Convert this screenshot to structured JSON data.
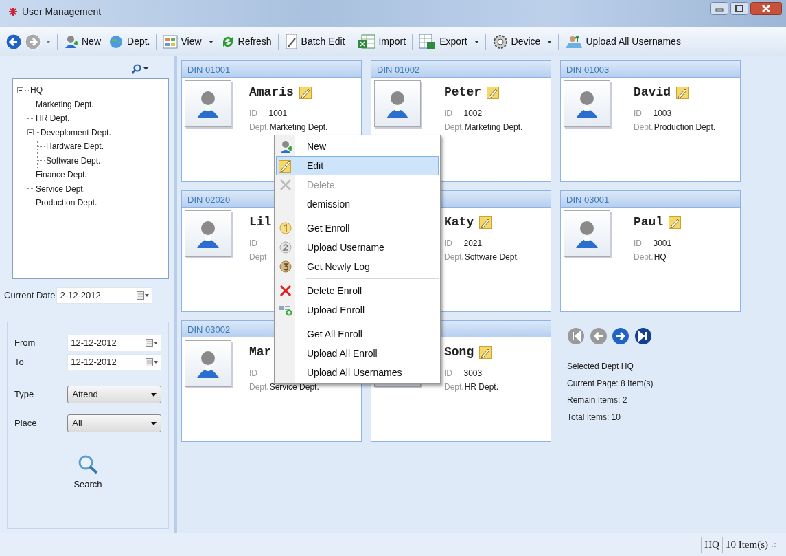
{
  "window": {
    "title": "User Management"
  },
  "toolbar": [
    {
      "kind": "back",
      "disabled": false
    },
    {
      "kind": "forward",
      "disabled": true,
      "dropdown": true
    },
    {
      "kind": "new",
      "label": "New"
    },
    {
      "kind": "dept",
      "label": "Dept."
    },
    {
      "kind": "view",
      "label": "View",
      "dropdown": true
    },
    {
      "kind": "refresh",
      "label": "Refresh"
    },
    {
      "kind": "batch",
      "label": "Batch Edit"
    },
    {
      "kind": "import",
      "label": "Import"
    },
    {
      "kind": "export",
      "label": "Export",
      "dropdown": true
    },
    {
      "kind": "device",
      "label": "Device",
      "dropdown": true
    },
    {
      "kind": "upload",
      "label": "Upload All Usernames"
    }
  ],
  "tree": [
    {
      "label": "HQ",
      "expanded": true,
      "children": [
        {
          "label": "Marketing Dept."
        },
        {
          "label": "HR Dept."
        },
        {
          "label": "Deveploment Dept.",
          "expanded": true,
          "children": [
            {
              "label": "Hardware Dept."
            },
            {
              "label": "Software Dept."
            }
          ]
        },
        {
          "label": "Finance Dept."
        },
        {
          "label": "Service Dept."
        },
        {
          "label": "Production Dept."
        }
      ]
    }
  ],
  "current_date": {
    "label": "Current Date",
    "value": "2-12-2012"
  },
  "filter": {
    "from": {
      "label": "From",
      "value": "12-12-2012"
    },
    "to": {
      "label": "To",
      "value": "12-12-2012"
    },
    "type": {
      "label": "Type",
      "value": "Attend"
    },
    "place": {
      "label": "Place",
      "value": "All"
    },
    "search": "Search"
  },
  "cards": [
    {
      "din": "DIN 01001",
      "name": "Amaris",
      "id_label": "ID",
      "id": "1001",
      "dept_label": "Dept.",
      "dept": "Marketing Dept."
    },
    {
      "din": "DIN 01002",
      "name": "Peter",
      "id_label": "ID",
      "id": "1002",
      "dept_label": "Dept.",
      "dept": "Marketing Dept."
    },
    {
      "din": "DIN 01003",
      "name": "David",
      "id_label": "ID",
      "id": "1003",
      "dept_label": "Dept.",
      "dept": "Production Dept."
    },
    {
      "din": "DIN 02020",
      "name": "Lil",
      "id_label": "ID",
      "dept_label": "Dept"
    },
    {
      "name": "Katy",
      "id_label": "ID",
      "id": "2021",
      "dept_label": "Dept.",
      "dept": "Software Dept."
    },
    {
      "din": "DIN 03001",
      "name": "Paul",
      "id_label": "ID",
      "id": "3001",
      "dept_label": "Dept.",
      "dept": "HQ"
    },
    {
      "din": "DIN 03002",
      "name": "Mar",
      "id_label": "ID",
      "dept_label": "Dept.",
      "dept": "Service Dept."
    },
    {
      "name": "Song",
      "id_label": "ID",
      "id": "3003",
      "dept_label": "Dept.",
      "dept": "HR Dept."
    }
  ],
  "pager": [
    {
      "kind": "first",
      "disabled": true
    },
    {
      "kind": "prev",
      "disabled": true
    },
    {
      "kind": "next",
      "disabled": false
    },
    {
      "kind": "last",
      "disabled": false
    }
  ],
  "info": [
    "Selected Dept HQ",
    "Current Page: 8 Item(s)",
    "Remain Items: 2",
    "Total Items: 10"
  ],
  "context_menu": [
    [
      {
        "kind": "new",
        "label": "New",
        "selected": false,
        "disabled": false
      },
      {
        "kind": "edit",
        "label": "Edit",
        "selected": true,
        "disabled": false
      },
      {
        "kind": "delete",
        "label": "Delete",
        "selected": false,
        "disabled": true
      },
      {
        "kind": "none",
        "label": "demission",
        "selected": false,
        "disabled": false
      }
    ],
    [
      {
        "kind": "one",
        "label": "Get Enroll",
        "selected": false,
        "disabled": false
      },
      {
        "kind": "two",
        "label": "Upload Username",
        "selected": false,
        "disabled": false
      },
      {
        "kind": "three",
        "label": "Get Newly Log",
        "selected": false,
        "disabled": false
      }
    ],
    [
      {
        "kind": "remove",
        "label": "Delete Enroll",
        "selected": false,
        "disabled": false
      },
      {
        "kind": "add",
        "label": "Upload Enroll",
        "selected": false,
        "disabled": false
      }
    ],
    [
      {
        "kind": "none",
        "label": "Get All Enroll",
        "selected": false,
        "disabled": false
      },
      {
        "kind": "none",
        "label": "Upload All Enroll",
        "selected": false,
        "disabled": false
      },
      {
        "kind": "none",
        "label": "Upload All Usernames",
        "selected": false,
        "disabled": false
      }
    ]
  ],
  "status_bar": [
    "HQ",
    "10 Item(s)"
  ]
}
